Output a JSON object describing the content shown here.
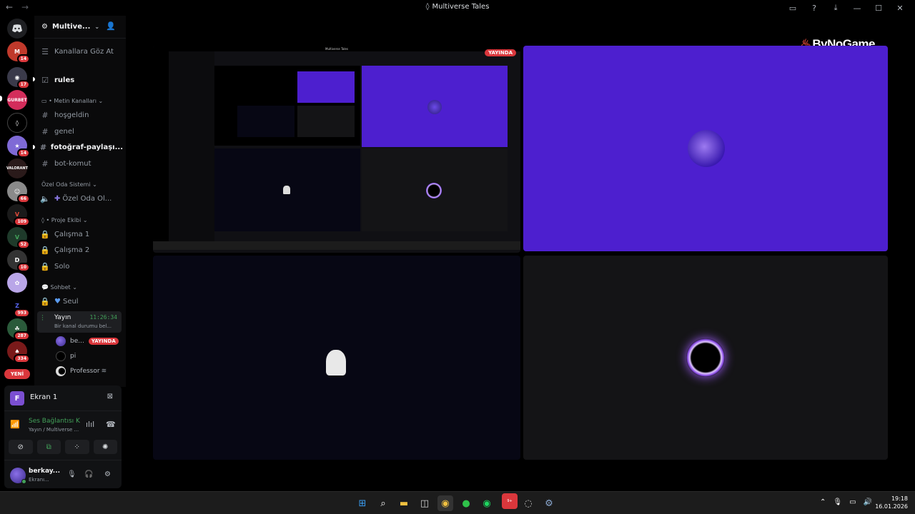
{
  "window": {
    "title": "Multiverse Tales",
    "back": "←",
    "forward": "→"
  },
  "rail": {
    "badges": [
      "14",
      "17",
      "14",
      "66",
      "109",
      "52",
      "10",
      "993",
      "287",
      "334"
    ],
    "gurbet_label": "GURBET",
    "valorant_label": "VALORANT",
    "new_label": "YENİ"
  },
  "server": {
    "name": "Multive...",
    "browse": "Kanallara Göz At",
    "rules": "rules",
    "categories": {
      "text": "Metin Kanalları",
      "voice": "Özel Oda Sistemi",
      "project": "Proje Ekibi",
      "chat": "Sohbet"
    },
    "channels": {
      "hosgeldin": "hoşgeldin",
      "genel": "genel",
      "foto": "fotoğraf-paylaşı...",
      "bot": "bot-komut",
      "ozel": "Özel Oda Ol...",
      "calisma1": "Çalışma 1",
      "calisma2": "Çalışma 2",
      "solo": "Solo",
      "seul": "Seul"
    },
    "voice_active": {
      "name": "Yayın",
      "time": "11:26:34",
      "status": "Bir kanal durumu bel..."
    },
    "members": [
      {
        "name": "be...",
        "live": "YAYINDA"
      },
      {
        "name": "pi"
      },
      {
        "name": "Professor"
      }
    ]
  },
  "panel": {
    "stream_label": "Ekran 1",
    "stream_initial": "F",
    "conn_title": "Ses Bağlantısı K",
    "conn_sub": "Yayın / Multiverse ...",
    "user_name": "berkay...",
    "user_status": "Ekranı..."
  },
  "stage": {
    "brand": "ByNoGame",
    "live_label": "YAYINDA",
    "mini_title": "Multiverse Tales",
    "colors": {
      "purple": "#4d1fcf",
      "dark_tile": "#070714",
      "gray_tile": "#141416"
    }
  },
  "taskbar": {
    "time": "19:18",
    "date": "16.01.2026",
    "discord_badge": "9+"
  }
}
